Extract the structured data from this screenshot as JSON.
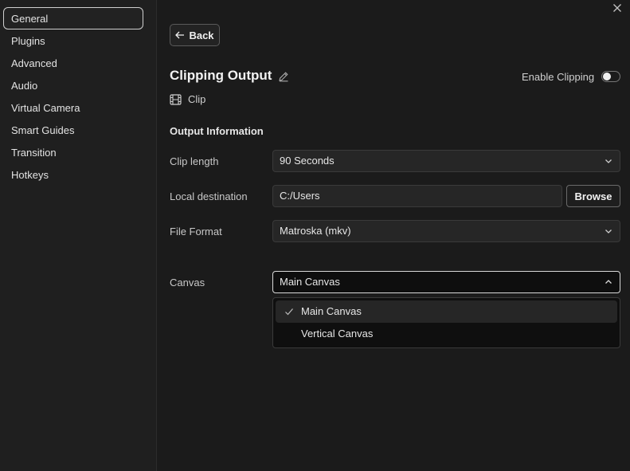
{
  "sidebar": {
    "items": [
      {
        "label": "General",
        "active": true
      },
      {
        "label": "Plugins"
      },
      {
        "label": "Advanced"
      },
      {
        "label": "Audio"
      },
      {
        "label": "Virtual Camera"
      },
      {
        "label": "Smart Guides"
      },
      {
        "label": "Transition"
      },
      {
        "label": "Hotkeys"
      }
    ]
  },
  "header": {
    "back_label": "Back",
    "title": "Clipping Output",
    "enable_label": "Enable Clipping",
    "enabled": false,
    "clip_label": "Clip"
  },
  "output": {
    "section_title": "Output Information",
    "clip_length_label": "Clip length",
    "clip_length_value": "90 Seconds",
    "local_destination_label": "Local destination",
    "local_destination_value": "C:/Users",
    "browse_label": "Browse",
    "file_format_label": "File Format",
    "file_format_value": "Matroska (mkv)",
    "canvas_label": "Canvas",
    "canvas_value": "Main Canvas",
    "canvas_options": [
      "Main Canvas",
      "Vertical Canvas"
    ]
  },
  "icons": {
    "close": "close-icon",
    "back": "arrow-left-icon",
    "edit": "pencil-icon",
    "clip": "film-icon",
    "chevron_down": "chevron-down-icon",
    "chevron_up": "chevron-up-icon",
    "check": "check-icon"
  }
}
